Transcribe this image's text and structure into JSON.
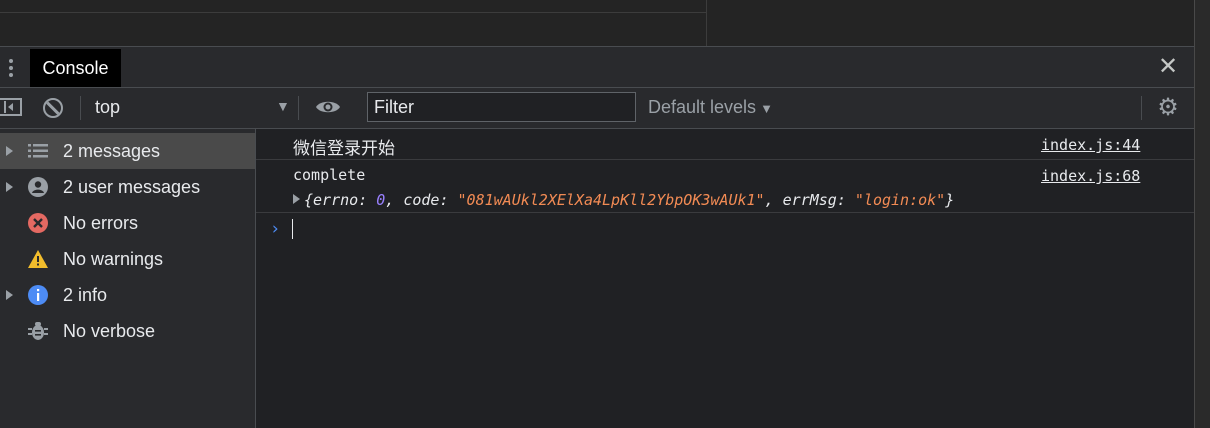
{
  "drawer": {
    "tab_label": "Console",
    "close_glyph": "✕"
  },
  "toolbar": {
    "context": "top",
    "context_arrow": "▼",
    "filter_placeholder": "Filter",
    "levels_label": "Default levels",
    "levels_arrow": "▼",
    "gear_glyph": "⚙"
  },
  "sidebar": {
    "items": [
      {
        "label": "2 messages",
        "icon": "list-icon",
        "expandable": true,
        "selected": true
      },
      {
        "label": "2 user messages",
        "icon": "user-icon",
        "expandable": true,
        "selected": false
      },
      {
        "label": "No errors",
        "icon": "error-icon",
        "expandable": false,
        "selected": false
      },
      {
        "label": "No warnings",
        "icon": "warning-icon",
        "expandable": false,
        "selected": false
      },
      {
        "label": "2 info",
        "icon": "info-icon",
        "expandable": true,
        "selected": false
      },
      {
        "label": "No verbose",
        "icon": "bug-icon",
        "expandable": false,
        "selected": false
      }
    ]
  },
  "messages": [
    {
      "text": "微信登录开始",
      "source": "index.js:44"
    },
    {
      "text": "complete",
      "source": "index.js:68",
      "object": {
        "open": "{",
        "k1": "errno",
        "v1": "0",
        "k2": "code",
        "v2": "\"081wAUkl2XElXa4LpKll2YbpOK3wAUk1\"",
        "k3": "errMsg",
        "v3": "\"login:ok\"",
        "close": "}"
      }
    }
  ],
  "prompt_glyph": "›",
  "colors": {
    "background": "#202124",
    "toolbar": "#292a2d",
    "string": "#f28b54",
    "number": "#9980ff",
    "prompt": "#4d8cf5",
    "error": "#e46962",
    "warning": "#f2bd2c",
    "info": "#4d8cf5"
  }
}
